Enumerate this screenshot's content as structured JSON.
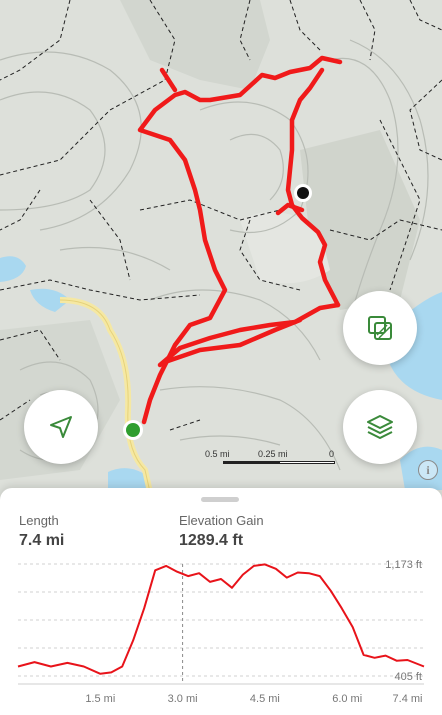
{
  "map": {
    "scale_bar": {
      "labels": [
        "0.5 mi",
        "0.25 mi",
        "0"
      ]
    },
    "info_label": "i",
    "locate_button_icon": "navigation-arrow-icon",
    "overlay_button_icon": "map-overlay-icon",
    "layers_button_icon": "layers-icon"
  },
  "stats": {
    "length": {
      "label": "Length",
      "value": "7.4 mi"
    },
    "elevation_gain": {
      "label": "Elevation Gain",
      "value": "1289.4 ft"
    }
  },
  "chart_data": {
    "type": "area",
    "xlabel": "",
    "ylabel": "",
    "x_ticks": [
      "1.5 mi",
      "3.0 mi",
      "4.5 mi",
      "6.0 mi",
      "7.4 mi"
    ],
    "y_ticks": [
      "1,173 ft",
      "405 ft"
    ],
    "ylim": [
      405,
      1173
    ],
    "xlim": [
      0,
      7.4
    ],
    "current_marker_x": 3.0,
    "x": [
      0.0,
      0.3,
      0.6,
      0.9,
      1.2,
      1.5,
      1.7,
      1.9,
      2.1,
      2.3,
      2.5,
      2.7,
      2.9,
      3.1,
      3.3,
      3.5,
      3.7,
      3.9,
      4.1,
      4.3,
      4.5,
      4.7,
      4.9,
      5.1,
      5.3,
      5.5,
      5.7,
      5.9,
      6.1,
      6.3,
      6.5,
      6.7,
      6.9,
      7.1,
      7.4
    ],
    "y": [
      470,
      500,
      470,
      495,
      470,
      420,
      430,
      470,
      650,
      870,
      1130,
      1160,
      1120,
      1090,
      1110,
      1050,
      1070,
      1010,
      1100,
      1160,
      1170,
      1140,
      1080,
      1115,
      1110,
      1090,
      990,
      870,
      740,
      550,
      530,
      545,
      510,
      515,
      470
    ],
    "colors": {
      "line": "#e8131a",
      "marker": "#8a8a8a",
      "grid": "#d2d2d2"
    }
  },
  "colors": {
    "trail": "#f01a1a",
    "start_marker": "#2f9e2f",
    "current_marker": "#111111",
    "icon": "#3a8a3a"
  }
}
